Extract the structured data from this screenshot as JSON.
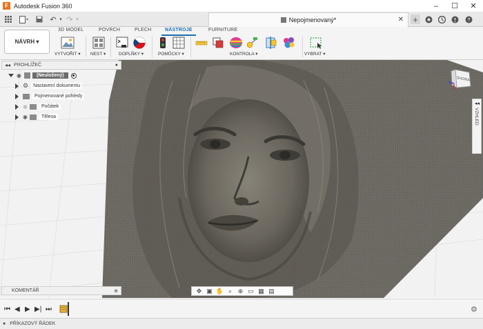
{
  "window": {
    "app_title": "Autodesk Fusion 360",
    "minimize_glyph": "–",
    "maximize_glyph": "☐",
    "close_glyph": "✕"
  },
  "tabs": {
    "doc_title": "Nepojmenovaný*",
    "close_glyph": "✕",
    "new_tab_glyph": "+"
  },
  "ribbon": {
    "nav_button": "NÁVRH ▾",
    "tabs": [
      "3D MODEL",
      "POVRCH",
      "PLECH",
      "NÁSTROJE",
      "FURNITURE"
    ],
    "groups": [
      "VYTVOŘIT ▾",
      "NEST ▾",
      "DOPLŇKY ▾",
      "POMŮCKY ▾",
      "KONTROLA ▾",
      "VYBRAT ▾"
    ]
  },
  "browser": {
    "title": "PROHLÍŽEČ",
    "root": "(Neuložený)",
    "items": [
      "Nastavení dokumentu",
      "Pojmenované pohledy",
      "Počátek",
      "Tělesa"
    ]
  },
  "viewcube_label": "SHORA",
  "side_panel": "VZHLED",
  "comments_label": "KOMENTÁŘ",
  "status_label": "PŘÍKAZOVÝ ŘÁDEK",
  "colors": {
    "accent": "#1a6fb5",
    "relief_dark": "#4d4b45",
    "relief_light": "#77746b",
    "app_orange": "#e8731f"
  }
}
